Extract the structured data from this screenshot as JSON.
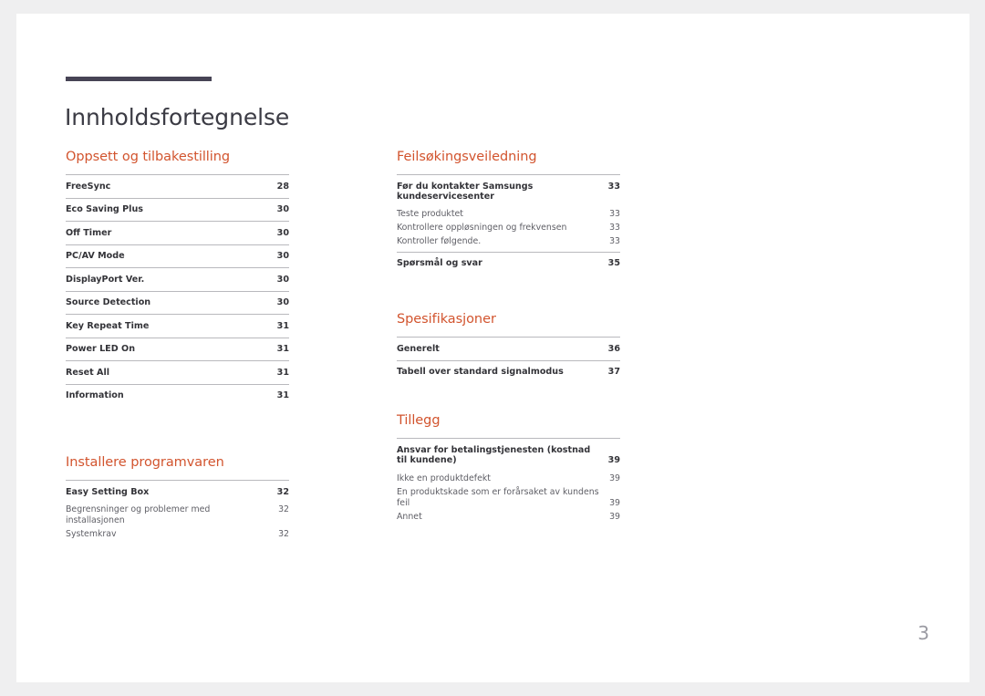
{
  "document": {
    "title": "Innholdsfortegnelse",
    "page_number": "3",
    "accent_color": "#d2542e",
    "rule_color": "#474455"
  },
  "columns": {
    "left": [
      {
        "heading": "Oppsett og tilbakestilling",
        "entries": [
          {
            "label": "FreeSync",
            "page": "28",
            "level": "main"
          },
          {
            "label": "Eco Saving Plus",
            "page": "30",
            "level": "main"
          },
          {
            "label": "Off Timer",
            "page": "30",
            "level": "main"
          },
          {
            "label": "PC/AV Mode",
            "page": "30",
            "level": "main"
          },
          {
            "label": "DisplayPort Ver.",
            "page": "30",
            "level": "main"
          },
          {
            "label": "Source Detection",
            "page": "30",
            "level": "main"
          },
          {
            "label": "Key Repeat Time",
            "page": "31",
            "level": "main"
          },
          {
            "label": "Power LED On",
            "page": "31",
            "level": "main"
          },
          {
            "label": "Reset All",
            "page": "31",
            "level": "main"
          },
          {
            "label": "Information",
            "page": "31",
            "level": "main"
          }
        ]
      },
      {
        "heading": "Installere programvaren",
        "entries": [
          {
            "label": "Easy Setting Box",
            "page": "32",
            "level": "main"
          },
          {
            "label": "Begrensninger og problemer med installasjonen",
            "page": "32",
            "level": "sub"
          },
          {
            "label": "Systemkrav",
            "page": "32",
            "level": "sub"
          }
        ]
      }
    ],
    "right": [
      {
        "heading": "Feilsøkingsveiledning",
        "entries": [
          {
            "label": "Før du kontakter Samsungs kundeservicesenter",
            "page": "33",
            "level": "main"
          },
          {
            "label": "Teste produktet",
            "page": "33",
            "level": "sub"
          },
          {
            "label": "Kontrollere oppløsningen og frekvensen",
            "page": "33",
            "level": "sub"
          },
          {
            "label": "Kontroller følgende.",
            "page": "33",
            "level": "sub"
          },
          {
            "label": "Spørsmål og svar",
            "page": "35",
            "level": "main"
          }
        ]
      },
      {
        "heading": "Spesifikasjoner",
        "entries": [
          {
            "label": "Generelt",
            "page": "36",
            "level": "main"
          },
          {
            "label": "Tabell over standard signalmodus",
            "page": "37",
            "level": "main"
          }
        ]
      },
      {
        "heading": "Tillegg",
        "entries": [
          {
            "label": "Ansvar for betalingstjenesten (kostnad til kundene)",
            "page": "39",
            "level": "main"
          },
          {
            "label": "Ikke en produktdefekt",
            "page": "39",
            "level": "sub"
          },
          {
            "label": "En produktskade som er forårsaket av kundens feil",
            "page": "39",
            "level": "sub"
          },
          {
            "label": "Annet",
            "page": "39",
            "level": "sub"
          }
        ]
      }
    ]
  }
}
